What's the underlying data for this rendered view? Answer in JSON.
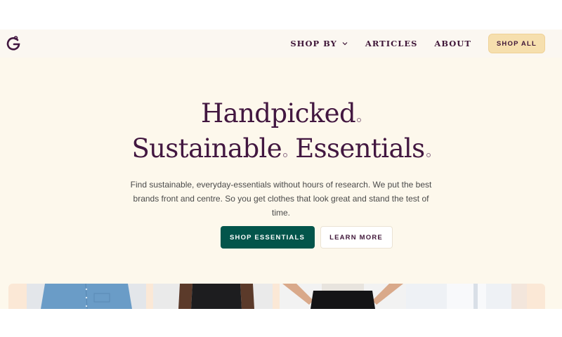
{
  "nav": {
    "logo_icon": "brand-logo-icon",
    "shop_by": "SHOP BY",
    "articles": "ARTICLES",
    "about": "ABOUT",
    "shop_all": "SHOP ALL"
  },
  "hero": {
    "line1": "Handpicked",
    "line2a": "Sustainable",
    "line2b": "Essentials",
    "subtitle": "Find sustainable, everyday-essentials without hours of research. We put the best brands front and centre. So you get clothes that look great and stand the test of time.",
    "primary_cta": "SHOP ESSENTIALS",
    "secondary_cta": "LEARN MORE"
  },
  "colors": {
    "brand": "#421740",
    "hero_bg": "#fdf8ec",
    "primary_button": "#03554b",
    "shop_all_button": "#f6dfae"
  },
  "products": [
    {
      "icon": "blue-shirt-image"
    },
    {
      "icon": "black-top-image"
    },
    {
      "icon": "black-pants-image"
    },
    {
      "icon": "light-shirt-image"
    }
  ]
}
